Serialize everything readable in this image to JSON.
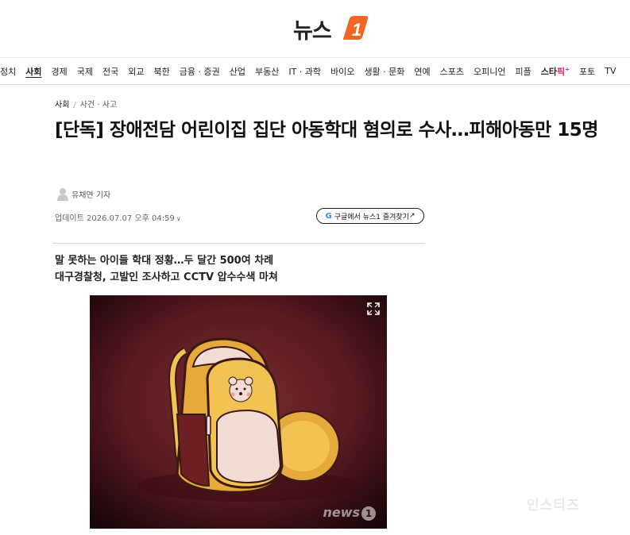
{
  "header": {
    "logo_text": "뉴스",
    "logo_mark": "1"
  },
  "nav": {
    "items": [
      "정치",
      "사회",
      "경제",
      "국제",
      "전국",
      "외교",
      "북한",
      "금융 · 증권",
      "산업",
      "부동산",
      "IT · 과학",
      "바이오",
      "생활 · 문화",
      "연예",
      "스포츠",
      "오피니언",
      "피플"
    ],
    "star_prefix": "스타",
    "star_pink": "픽",
    "star_sup": "+",
    "tail": [
      "포토",
      "TV"
    ],
    "active": "사회"
  },
  "breadcrumb": {
    "section": "사회",
    "subsection": "사건 · 사고"
  },
  "article": {
    "headline": "[단독] 장애전담 어린이집 집단 아동학대 혐의로 수사…피해아동만 15명",
    "author": "유채연 기자",
    "updated": "업데이트 2026.07.07 오후 04:59",
    "google_btn": "구글에서 뉴스1 즐겨찾기",
    "google_arrow": "↗",
    "subheads": [
      "말 못하는 아이들 학대 정황…두 달간 500여 차례",
      "대구경찰청, 고발인 조사하고 CCTV 압수수색 마쳐"
    ],
    "photo_watermark": "news",
    "photo_watermark_mark": "1"
  },
  "page_watermark": "인스티즈",
  "colors": {
    "brand_orange": "#f26522",
    "photo_bg": "#5a1a20",
    "bag_yellow": "#f2c255",
    "bag_dark": "#6e1f24"
  }
}
